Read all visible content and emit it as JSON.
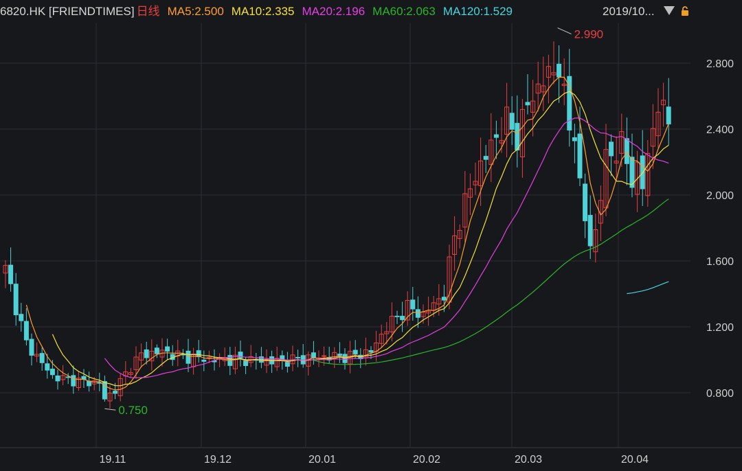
{
  "header": {
    "symbol": "6820.HK [FRIENDTIMES]",
    "period": "日线",
    "ma5": "MA5:2.500",
    "ma10": "MA10:2.335",
    "ma20": "MA20:2.196",
    "ma60": "MA60:2.063",
    "ma120": "MA120:1.529",
    "date": "2019/10..."
  },
  "colors": {
    "background": "#17181c",
    "grid": "#2c2d33",
    "up": "#e8403f",
    "down": "#4fd2d7",
    "ma5": "#ff9d2e",
    "ma10": "#f6e03b",
    "ma20": "#e53fe3",
    "ma60": "#2bb52b",
    "ma120": "#48d5dc",
    "axis_text": "#d0d0d0"
  },
  "chart_data": {
    "type": "candlestick",
    "y_ticks": [
      "2.800",
      "2.400",
      "2.000",
      "1.600",
      "1.200",
      "0.800"
    ],
    "x_ticks": [
      "19.11",
      "19.12",
      "20.01",
      "20.02",
      "20.03",
      "20.04"
    ],
    "ylim": [
      0.6,
      3.1
    ],
    "high_label": "2.990",
    "low_label": "0.750",
    "grid": true,
    "ma_series": [
      {
        "name": "MA5"
      },
      {
        "name": "MA10"
      },
      {
        "name": "MA20"
      },
      {
        "name": "MA60"
      },
      {
        "name": "MA120"
      }
    ]
  }
}
